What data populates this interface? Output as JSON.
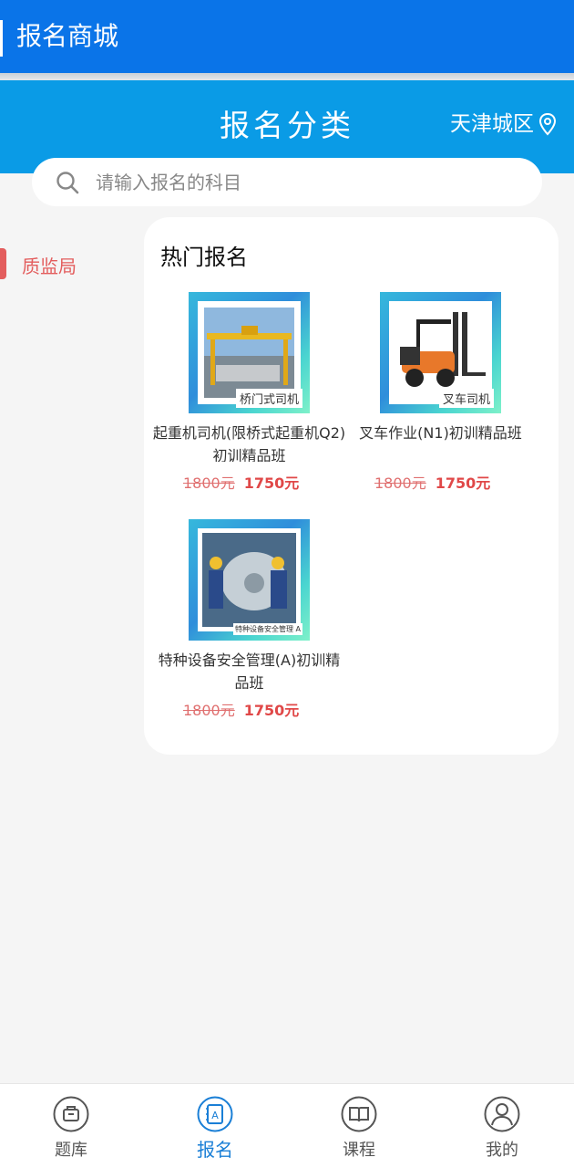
{
  "appbar": {
    "title": "报名商城"
  },
  "header": {
    "title": "报名分类",
    "location": "天津城区"
  },
  "search": {
    "placeholder": "请输入报名的科目"
  },
  "categories": [
    {
      "label": "质监局",
      "active": true
    }
  ],
  "hot": {
    "title": "热门报名",
    "products": [
      {
        "caption": "桥门式司机",
        "name": "起重机司机(限桥式起重机Q2)初训精品班",
        "old_price": "1800元",
        "price": "1750元"
      },
      {
        "caption": "叉车司机",
        "name": "叉车作业(N1)初训精品班",
        "old_price": "1800元",
        "price": "1750元"
      },
      {
        "caption": "特种设备安全管理 A",
        "name": "特种设备安全管理(A)初训精品班",
        "old_price": "1800元",
        "price": "1750元"
      }
    ]
  },
  "tabs": [
    {
      "label": "题库",
      "icon": "question-bank-icon"
    },
    {
      "label": "报名",
      "icon": "enroll-icon",
      "active": true
    },
    {
      "label": "课程",
      "icon": "book-icon"
    },
    {
      "label": "我的",
      "icon": "user-icon"
    }
  ],
  "colors": {
    "primary": "#0a74e8",
    "header": "#0a9be6",
    "accent": "#e35d5d",
    "tab_active": "#1a7fd6"
  }
}
